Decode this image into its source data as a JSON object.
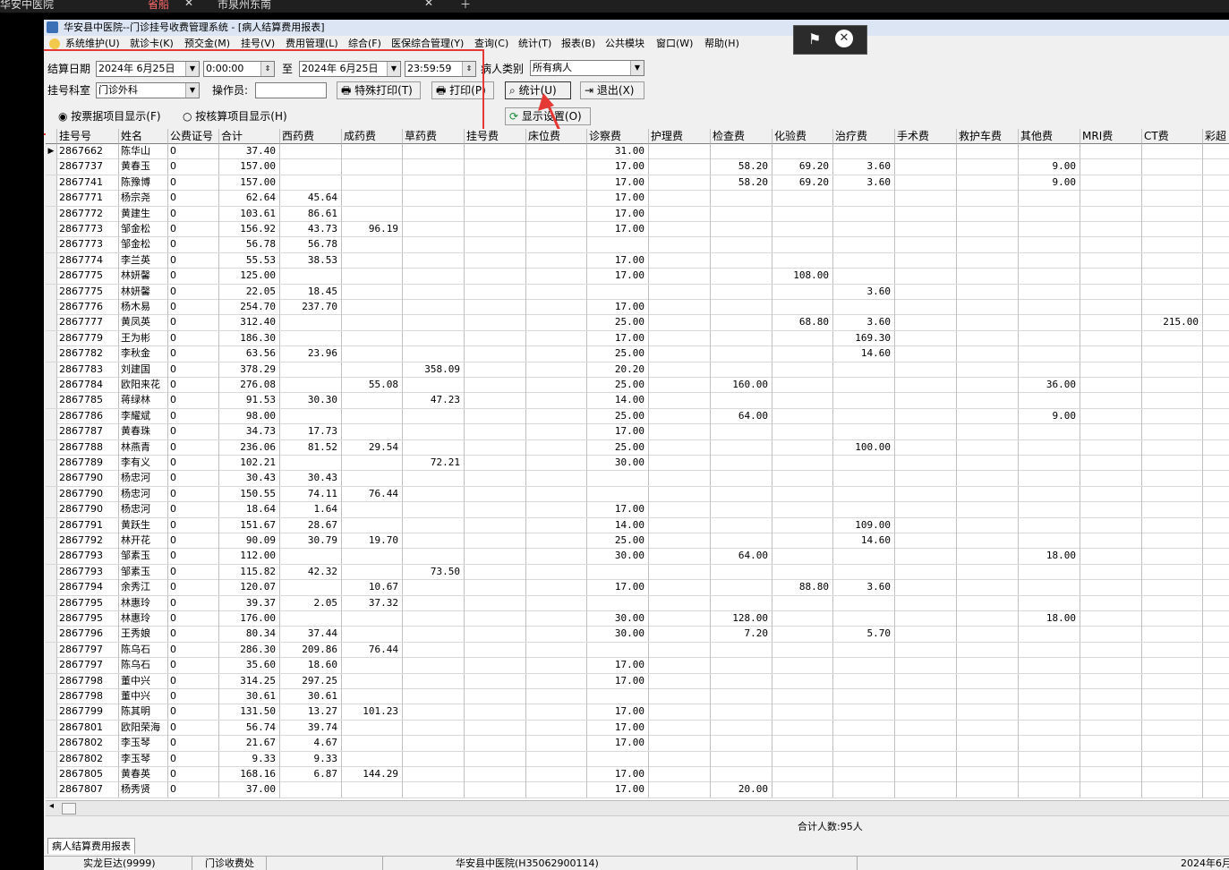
{
  "browser_tabs": [
    "华安中医院",
    "省船",
    "市泉州东南"
  ],
  "window": {
    "title": "华安县中医院--门诊挂号收费管理系统 - [病人结算费用报表]"
  },
  "menu": [
    "系统维护(U)",
    "就诊卡(K)",
    "预交金(M)",
    "挂号(V)",
    "费用管理(L)",
    "综合(F)",
    "医保综合管理(Y)",
    "查询(C)",
    "统计(T)",
    "报表(B)",
    "公共模块",
    "窗口(W)",
    "帮助(H)"
  ],
  "filters": {
    "settle_date_label": "结算日期",
    "start_date": "2024年 6月25日",
    "start_time": "0:00:00",
    "to_label": "至",
    "end_date": "2024年 6月25日",
    "end_time": "23:59:59",
    "patient_type_label": "病人类别",
    "patient_type": "所有病人",
    "dept_label": "挂号科室",
    "dept": "门诊外科",
    "operator_label": "操作员:",
    "operator": ""
  },
  "buttons": {
    "special_print": "特殊打印(T)",
    "print": "打印(P)",
    "stats": "统计(U)",
    "exit": "退出(X)",
    "display_settings": "显示设置(O)"
  },
  "radios": {
    "by_ticket": "按票据项目显示(F)",
    "by_account": "按核算项目显示(H)",
    "selected": "by_ticket"
  },
  "table": {
    "columns": [
      "挂号号",
      "姓名",
      "公费证号",
      "合计",
      "西药费",
      "成药费",
      "草药费",
      "挂号费",
      "床位费",
      "诊察费",
      "护理费",
      "检查费",
      "化验费",
      "治疗费",
      "手术费",
      "救护车费",
      "其他费",
      "MRI费",
      "CT费",
      "彩超"
    ],
    "rows": [
      [
        "2867662",
        "陈华山",
        "0",
        "37.40",
        "",
        "",
        "",
        "",
        "",
        "31.00",
        "",
        "",
        "",
        "",
        "",
        "",
        "",
        "",
        "",
        ""
      ],
      [
        "2867737",
        "黄春玉",
        "0",
        "157.00",
        "",
        "",
        "",
        "",
        "",
        "17.00",
        "",
        "58.20",
        "69.20",
        "3.60",
        "",
        "",
        "9.00",
        "",
        "",
        ""
      ],
      [
        "2867741",
        "陈豫博",
        "0",
        "157.00",
        "",
        "",
        "",
        "",
        "",
        "17.00",
        "",
        "58.20",
        "69.20",
        "3.60",
        "",
        "",
        "9.00",
        "",
        "",
        ""
      ],
      [
        "2867771",
        "杨宗尧",
        "0",
        "62.64",
        "45.64",
        "",
        "",
        "",
        "",
        "17.00",
        "",
        "",
        "",
        "",
        "",
        "",
        "",
        "",
        "",
        ""
      ],
      [
        "2867772",
        "黄建生",
        "0",
        "103.61",
        "86.61",
        "",
        "",
        "",
        "",
        "17.00",
        "",
        "",
        "",
        "",
        "",
        "",
        "",
        "",
        "",
        ""
      ],
      [
        "2867773",
        "邹金松",
        "0",
        "156.92",
        "43.73",
        "96.19",
        "",
        "",
        "",
        "17.00",
        "",
        "",
        "",
        "",
        "",
        "",
        "",
        "",
        "",
        ""
      ],
      [
        "2867773",
        "邹金松",
        "0",
        "56.78",
        "56.78",
        "",
        "",
        "",
        "",
        "",
        "",
        "",
        "",
        "",
        "",
        "",
        "",
        "",
        "",
        ""
      ],
      [
        "2867774",
        "李兰英",
        "0",
        "55.53",
        "38.53",
        "",
        "",
        "",
        "",
        "17.00",
        "",
        "",
        "",
        "",
        "",
        "",
        "",
        "",
        "",
        ""
      ],
      [
        "2867775",
        "林妍馨",
        "0",
        "125.00",
        "",
        "",
        "",
        "",
        "",
        "17.00",
        "",
        "",
        "108.00",
        "",
        "",
        "",
        "",
        "",
        "",
        ""
      ],
      [
        "2867775",
        "林妍馨",
        "0",
        "22.05",
        "18.45",
        "",
        "",
        "",
        "",
        "",
        "",
        "",
        "",
        "3.60",
        "",
        "",
        "",
        "",
        "",
        ""
      ],
      [
        "2867776",
        "杨木易",
        "0",
        "254.70",
        "237.70",
        "",
        "",
        "",
        "",
        "17.00",
        "",
        "",
        "",
        "",
        "",
        "",
        "",
        "",
        "",
        ""
      ],
      [
        "2867777",
        "黄凤英",
        "0",
        "312.40",
        "",
        "",
        "",
        "",
        "",
        "25.00",
        "",
        "",
        "68.80",
        "3.60",
        "",
        "",
        "",
        "",
        "215.00",
        ""
      ],
      [
        "2867779",
        "王为彬",
        "0",
        "186.30",
        "",
        "",
        "",
        "",
        "",
        "17.00",
        "",
        "",
        "",
        "169.30",
        "",
        "",
        "",
        "",
        "",
        ""
      ],
      [
        "2867782",
        "李秋金",
        "0",
        "63.56",
        "23.96",
        "",
        "",
        "",
        "",
        "25.00",
        "",
        "",
        "",
        "14.60",
        "",
        "",
        "",
        "",
        "",
        ""
      ],
      [
        "2867783",
        "刘建国",
        "0",
        "378.29",
        "",
        "",
        "358.09",
        "",
        "",
        "20.20",
        "",
        "",
        "",
        "",
        "",
        "",
        "",
        "",
        "",
        ""
      ],
      [
        "2867784",
        "欧阳来花",
        "0",
        "276.08",
        "",
        "55.08",
        "",
        "",
        "",
        "25.00",
        "",
        "160.00",
        "",
        "",
        "",
        "",
        "36.00",
        "",
        "",
        ""
      ],
      [
        "2867785",
        "蒋绿林",
        "0",
        "91.53",
        "30.30",
        "",
        "47.23",
        "",
        "",
        "14.00",
        "",
        "",
        "",
        "",
        "",
        "",
        "",
        "",
        "",
        ""
      ],
      [
        "2867786",
        "李耀斌",
        "0",
        "98.00",
        "",
        "",
        "",
        "",
        "",
        "25.00",
        "",
        "64.00",
        "",
        "",
        "",
        "",
        "9.00",
        "",
        "",
        ""
      ],
      [
        "2867787",
        "黄春珠",
        "0",
        "34.73",
        "17.73",
        "",
        "",
        "",
        "",
        "17.00",
        "",
        "",
        "",
        "",
        "",
        "",
        "",
        "",
        "",
        ""
      ],
      [
        "2867788",
        "林燕青",
        "0",
        "236.06",
        "81.52",
        "29.54",
        "",
        "",
        "",
        "25.00",
        "",
        "",
        "",
        "100.00",
        "",
        "",
        "",
        "",
        "",
        ""
      ],
      [
        "2867789",
        "李有义",
        "0",
        "102.21",
        "",
        "",
        "72.21",
        "",
        "",
        "30.00",
        "",
        "",
        "",
        "",
        "",
        "",
        "",
        "",
        "",
        ""
      ],
      [
        "2867790",
        "杨忠河",
        "0",
        "30.43",
        "30.43",
        "",
        "",
        "",
        "",
        "",
        "",
        "",
        "",
        "",
        "",
        "",
        "",
        "",
        "",
        ""
      ],
      [
        "2867790",
        "杨忠河",
        "0",
        "150.55",
        "74.11",
        "76.44",
        "",
        "",
        "",
        "",
        "",
        "",
        "",
        "",
        "",
        "",
        "",
        "",
        "",
        ""
      ],
      [
        "2867790",
        "杨忠河",
        "0",
        "18.64",
        "1.64",
        "",
        "",
        "",
        "",
        "17.00",
        "",
        "",
        "",
        "",
        "",
        "",
        "",
        "",
        "",
        ""
      ],
      [
        "2867791",
        "黄跃生",
        "0",
        "151.67",
        "28.67",
        "",
        "",
        "",
        "",
        "14.00",
        "",
        "",
        "",
        "109.00",
        "",
        "",
        "",
        "",
        "",
        ""
      ],
      [
        "2867792",
        "林开花",
        "0",
        "90.09",
        "30.79",
        "19.70",
        "",
        "",
        "",
        "25.00",
        "",
        "",
        "",
        "14.60",
        "",
        "",
        "",
        "",
        "",
        ""
      ],
      [
        "2867793",
        "邹素玉",
        "0",
        "112.00",
        "",
        "",
        "",
        "",
        "",
        "30.00",
        "",
        "64.00",
        "",
        "",
        "",
        "",
        "18.00",
        "",
        "",
        ""
      ],
      [
        "2867793",
        "邹素玉",
        "0",
        "115.82",
        "42.32",
        "",
        "73.50",
        "",
        "",
        "",
        "",
        "",
        "",
        "",
        "",
        "",
        "",
        "",
        "",
        ""
      ],
      [
        "2867794",
        "余秀江",
        "0",
        "120.07",
        "",
        "10.67",
        "",
        "",
        "",
        "17.00",
        "",
        "",
        "88.80",
        "3.60",
        "",
        "",
        "",
        "",
        "",
        ""
      ],
      [
        "2867795",
        "林惠玲",
        "0",
        "39.37",
        "2.05",
        "37.32",
        "",
        "",
        "",
        "",
        "",
        "",
        "",
        "",
        "",
        "",
        "",
        "",
        "",
        ""
      ],
      [
        "2867795",
        "林惠玲",
        "0",
        "176.00",
        "",
        "",
        "",
        "",
        "",
        "30.00",
        "",
        "128.00",
        "",
        "",
        "",
        "",
        "18.00",
        "",
        "",
        ""
      ],
      [
        "2867796",
        "王秀娘",
        "0",
        "80.34",
        "37.44",
        "",
        "",
        "",
        "",
        "30.00",
        "",
        "7.20",
        "",
        "5.70",
        "",
        "",
        "",
        "",
        "",
        ""
      ],
      [
        "2867797",
        "陈乌石",
        "0",
        "286.30",
        "209.86",
        "76.44",
        "",
        "",
        "",
        "",
        "",
        "",
        "",
        "",
        "",
        "",
        "",
        "",
        "",
        ""
      ],
      [
        "2867797",
        "陈乌石",
        "0",
        "35.60",
        "18.60",
        "",
        "",
        "",
        "",
        "17.00",
        "",
        "",
        "",
        "",
        "",
        "",
        "",
        "",
        "",
        ""
      ],
      [
        "2867798",
        "董中兴",
        "0",
        "314.25",
        "297.25",
        "",
        "",
        "",
        "",
        "17.00",
        "",
        "",
        "",
        "",
        "",
        "",
        "",
        "",
        "",
        ""
      ],
      [
        "2867798",
        "董中兴",
        "0",
        "30.61",
        "30.61",
        "",
        "",
        "",
        "",
        "",
        "",
        "",
        "",
        "",
        "",
        "",
        "",
        "",
        "",
        ""
      ],
      [
        "2867799",
        "陈其明",
        "0",
        "131.50",
        "13.27",
        "101.23",
        "",
        "",
        "",
        "17.00",
        "",
        "",
        "",
        "",
        "",
        "",
        "",
        "",
        "",
        ""
      ],
      [
        "2867801",
        "欧阳荣海",
        "0",
        "56.74",
        "39.74",
        "",
        "",
        "",
        "",
        "17.00",
        "",
        "",
        "",
        "",
        "",
        "",
        "",
        "",
        "",
        ""
      ],
      [
        "2867802",
        "李玉琴",
        "0",
        "21.67",
        "4.67",
        "",
        "",
        "",
        "",
        "17.00",
        "",
        "",
        "",
        "",
        "",
        "",
        "",
        "",
        "",
        ""
      ],
      [
        "2867802",
        "李玉琴",
        "0",
        "9.33",
        "9.33",
        "",
        "",
        "",
        "",
        "",
        "",
        "",
        "",
        "",
        "",
        "",
        "",
        "",
        "",
        ""
      ],
      [
        "2867805",
        "黄春英",
        "0",
        "168.16",
        "6.87",
        "144.29",
        "",
        "",
        "",
        "17.00",
        "",
        "",
        "",
        "",
        "",
        "",
        "",
        "",
        "",
        ""
      ],
      [
        "2867807",
        "杨秀贤",
        "0",
        "37.00",
        "",
        "",
        "",
        "",
        "",
        "17.00",
        "",
        "20.00",
        "",
        "",
        "",
        "",
        "",
        "",
        "",
        ""
      ]
    ]
  },
  "footer": {
    "total_patients": "合计人数:95人"
  },
  "bottom_tab": "病人结算费用报表",
  "status": {
    "user": "实龙巨达(9999)",
    "office": "门诊收费处",
    "hospital": "华安县中医院(H35062900114)",
    "date": "2024年6月"
  },
  "colors": {
    "annotation": "#e53935",
    "title_bar": "#dbe5f3"
  }
}
